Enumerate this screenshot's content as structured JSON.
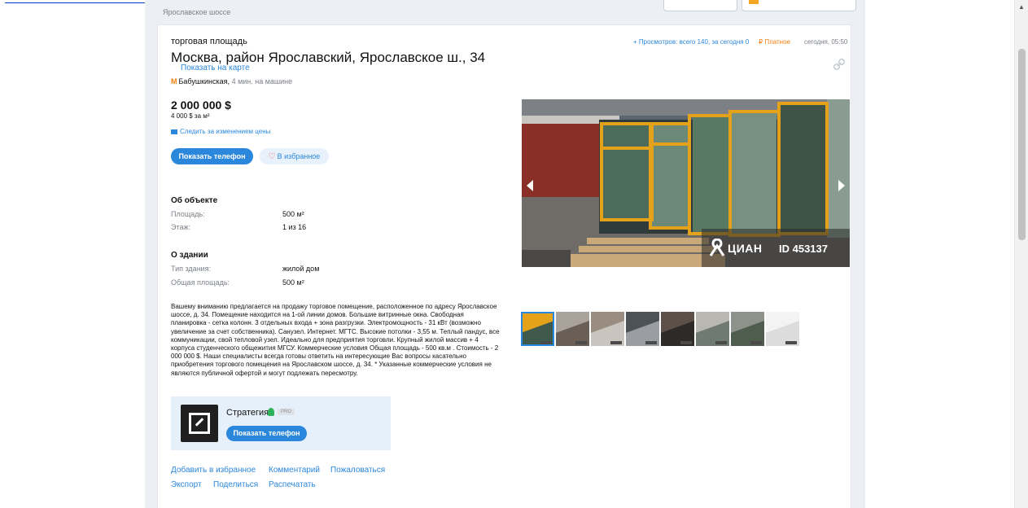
{
  "header": {
    "breadcrumb": "Ярославское шоссе"
  },
  "listing": {
    "category": "торговая площадь",
    "title": "Москва, район Ярославский, Ярославское ш., 34",
    "show_map": "Показать на карте",
    "metro_name": "Бабушкинская,",
    "metro_time": "4 мин. на машине",
    "stats": "+ Просмотров: всего 140, за сегодня 0",
    "paid": "₽ Платное",
    "date": "сегодня, 05:50",
    "price": "2 000 000 $",
    "price_per_m2": "4 000 $ за м²",
    "follow_price": "Следить за изменением цены",
    "show_phone": "Показать телефон",
    "favorite": "В избранное"
  },
  "object": {
    "title": "Об объекте",
    "rows": [
      {
        "label": "Площадь:",
        "value": "500 м²"
      },
      {
        "label": "Этаж:",
        "value": "1 из 16"
      }
    ]
  },
  "building": {
    "title": "О здании",
    "rows": [
      {
        "label": "Тип здания:",
        "value": "жилой дом"
      },
      {
        "label": "Общая площадь:",
        "value": "500 м²"
      }
    ]
  },
  "description": "Вашему вниманию предлагается на продажу торговое помещение, расположенное по адресу Ярославское шоссе, д. 34. Помещение находится на 1-ой линии домов. Большие витринные окна. Свободная планировка - сетка колонн. 3 отдельных входа + зона разгрузки. Электромощность - 31 кВт (возможно увеличение за счет собственника). Санузел. Интернет. МГТС. Высокие потолки - 3,55 м. Теплый пандус, все коммуникации, свой тепловой узел. Идеально для предприятия торговли. Крупный жилой массив + 4 корпуса студенческого общежития МГСУ. Коммерческие условия Общая площадь - 500 кв.м . Стоимость - 2 000 000 $. Наши специалисты всегда готовы ответить на интересующие Вас вопросы касательно приобретения торгового помещения на Ярославском шоссе, д. 34. * Указанные коммерческие условия не являются публичной офертой и могут подлежать пересмотру.",
  "agent": {
    "name": "Стратегия",
    "badge": "PRO",
    "show_phone": "Показать телефон"
  },
  "footer": {
    "add_favorite": "Добавить в избранное",
    "comment": "Комментарий",
    "complain": "Пожаловаться",
    "export": "Экспорт",
    "share": "Поделиться",
    "print": "Распечатать"
  },
  "gallery": {
    "brand": "ЦИАН",
    "id_label": "ID 453137",
    "thumbnail_count": 8
  },
  "colors": {
    "accent": "#2b87db",
    "metro": "#f27e0e",
    "paid": "#f27e0e"
  }
}
